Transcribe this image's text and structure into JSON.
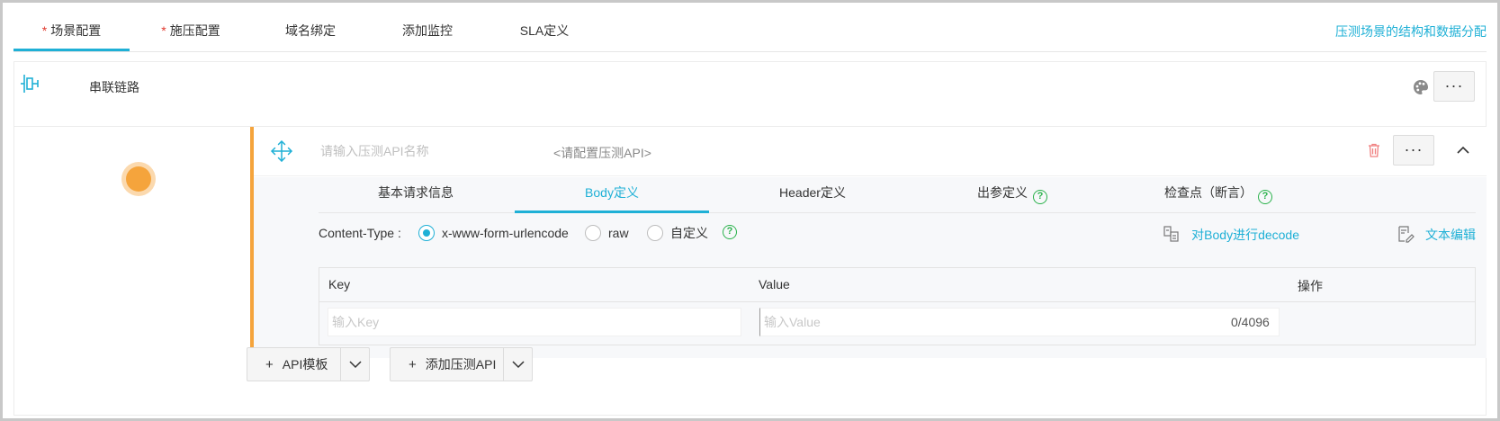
{
  "tabs": [
    {
      "label": "场景配置",
      "required": "*"
    },
    {
      "label": "施压配置",
      "required": "*"
    },
    {
      "label": "域名绑定",
      "required": ""
    },
    {
      "label": "添加监控",
      "required": ""
    },
    {
      "label": "SLA定义",
      "required": ""
    }
  ],
  "top_link": "压测场景的结构和数据分配",
  "chain": {
    "title": "串联链路",
    "more": "···"
  },
  "api": {
    "name_placeholder": "请输入压测API名称",
    "config_text": "<请配置压测API>",
    "more": "···"
  },
  "sub_tabs": [
    {
      "label": "基本请求信息"
    },
    {
      "label": "Body定义"
    },
    {
      "label": "Header定义"
    },
    {
      "label": "出参定义"
    },
    {
      "label": "检查点（断言）"
    }
  ],
  "help_glyph": "?",
  "content_type": {
    "label": "Content-Type :",
    "options": [
      "x-www-form-urlencode",
      "raw",
      "自定义"
    ],
    "selected": "x-www-form-urlencode"
  },
  "actions": {
    "decode": "对Body进行decode",
    "text_edit": "文本编辑"
  },
  "kv_table": {
    "headers": {
      "key": "Key",
      "value": "Value",
      "op": "操作"
    },
    "key_placeholder": "输入Key",
    "value_placeholder": "输入Value",
    "counter": "0/4096"
  },
  "buttons": {
    "plus": "+",
    "api_template": "API模板",
    "add_api": "添加压测API"
  },
  "colors": {
    "accent": "#1fb0d6",
    "orange": "#f5a43c",
    "help_green": "#2bb24c",
    "required_red": "#e0392e"
  }
}
